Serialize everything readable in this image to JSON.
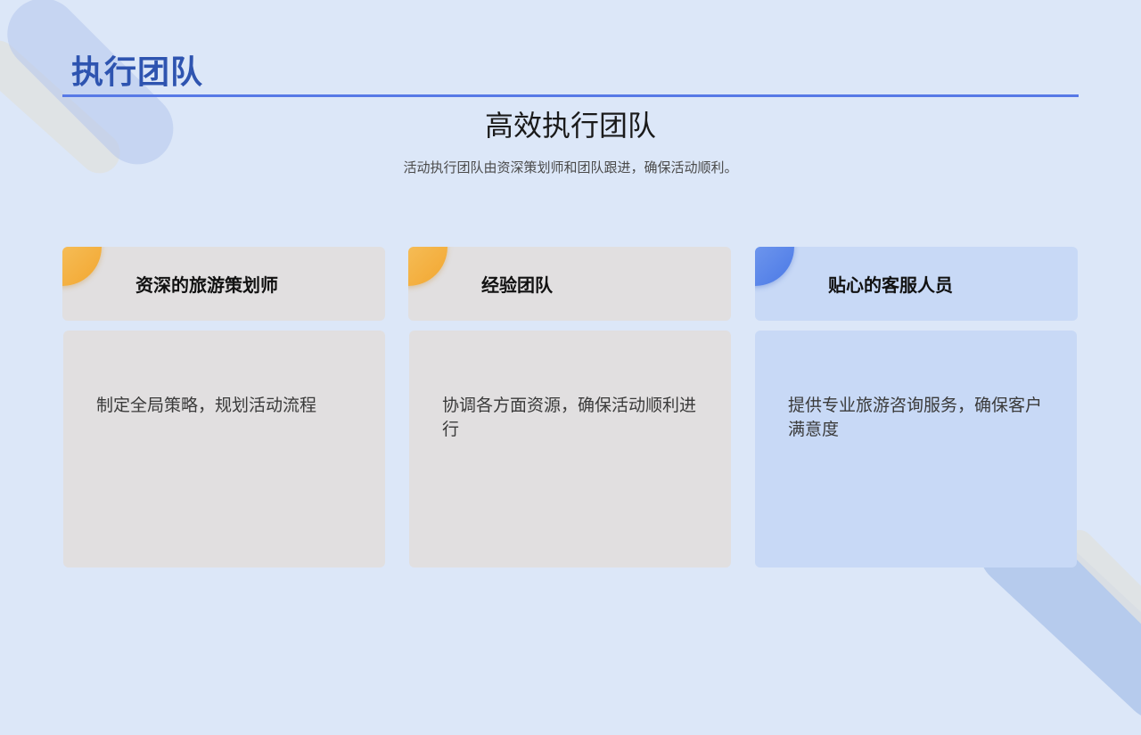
{
  "header": {
    "title": "执行团队"
  },
  "intro": {
    "subtitle": "高效执行团队",
    "summary": "活动执行团队由资深策划师和团队跟进，确保活动顺利。"
  },
  "cards": [
    {
      "title": "资深的旅游策划师",
      "description": "制定全局策略，规划活动流程",
      "theme": "gray",
      "accent": "#f2a62f"
    },
    {
      "title": "经验团队",
      "description": "协调各方面资源，确保活动顺利进行",
      "theme": "gray",
      "accent": "#f2a62f"
    },
    {
      "title": "贴心的客服人员",
      "description": "提供专业旅游咨询服务，确保客户满意度",
      "theme": "blue",
      "accent": "#4a78e6"
    }
  ],
  "colors": {
    "background": "#dce7f8",
    "title": "#2e54b0",
    "rule": "#5779e6",
    "card_gray": "#e1dfe0",
    "card_blue": "#c8d9f6"
  }
}
